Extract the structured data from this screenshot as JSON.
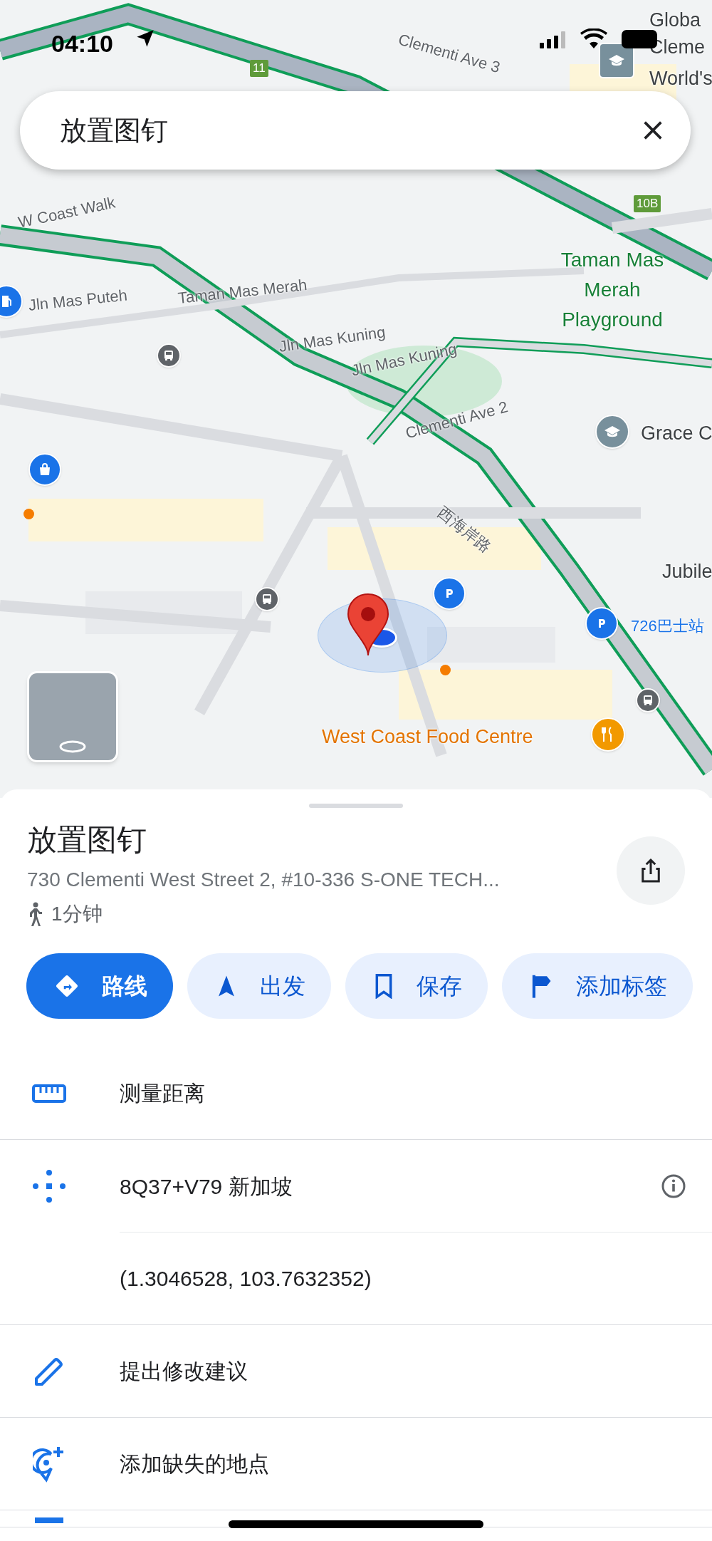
{
  "status_bar": {
    "time": "04:10"
  },
  "search": {
    "value": "放置图钉"
  },
  "map": {
    "road_badges": [
      "11",
      "10B"
    ],
    "labels": [
      {
        "text": "Clementi Ave 3",
        "kind": "road"
      },
      {
        "text": "Globa",
        "kind": "place"
      },
      {
        "text": "Cleme",
        "kind": "place"
      },
      {
        "text": "World's",
        "kind": "place"
      },
      {
        "text": "W Coast Walk",
        "kind": "road"
      },
      {
        "text": "Jln Mas Puteh",
        "kind": "road"
      },
      {
        "text": "Taman Mas Merah",
        "kind": "road"
      },
      {
        "text": "Jln Mas Kuning",
        "kind": "road"
      },
      {
        "text": "Jln Mas Kuning",
        "kind": "road"
      },
      {
        "text": "Taman Mas Merah Playground",
        "kind": "park"
      },
      {
        "text": "Clementi Ave 2",
        "kind": "road"
      },
      {
        "text": "西海岸路",
        "kind": "road"
      },
      {
        "text": "Grace C",
        "kind": "place"
      },
      {
        "text": "Jubile",
        "kind": "place"
      },
      {
        "text": "726巴士站",
        "kind": "transit"
      },
      {
        "text": "West Coast Food Centre",
        "kind": "food"
      }
    ]
  },
  "place": {
    "title": "放置图钉",
    "address": "730 Clementi West Street 2, #10-336 S-ONE TECH...",
    "walk_time": "1分钟"
  },
  "actions": [
    {
      "label": "路线",
      "kind": "directions",
      "selected": true
    },
    {
      "label": "出发",
      "kind": "start",
      "selected": false
    },
    {
      "label": "保存",
      "kind": "save",
      "selected": false
    },
    {
      "label": "添加标签",
      "kind": "label",
      "selected": false
    }
  ],
  "rows": [
    {
      "kind": "measure",
      "text": "测量距离"
    },
    {
      "kind": "pluscode",
      "text": "8Q37+V79 新加坡"
    },
    {
      "kind": "coords",
      "text": "(1.3046528, 103.7632352)"
    },
    {
      "kind": "edit",
      "text": "提出修改建议"
    },
    {
      "kind": "add-place",
      "text": "添加缺失的地点"
    },
    {
      "kind": "partial"
    }
  ]
}
